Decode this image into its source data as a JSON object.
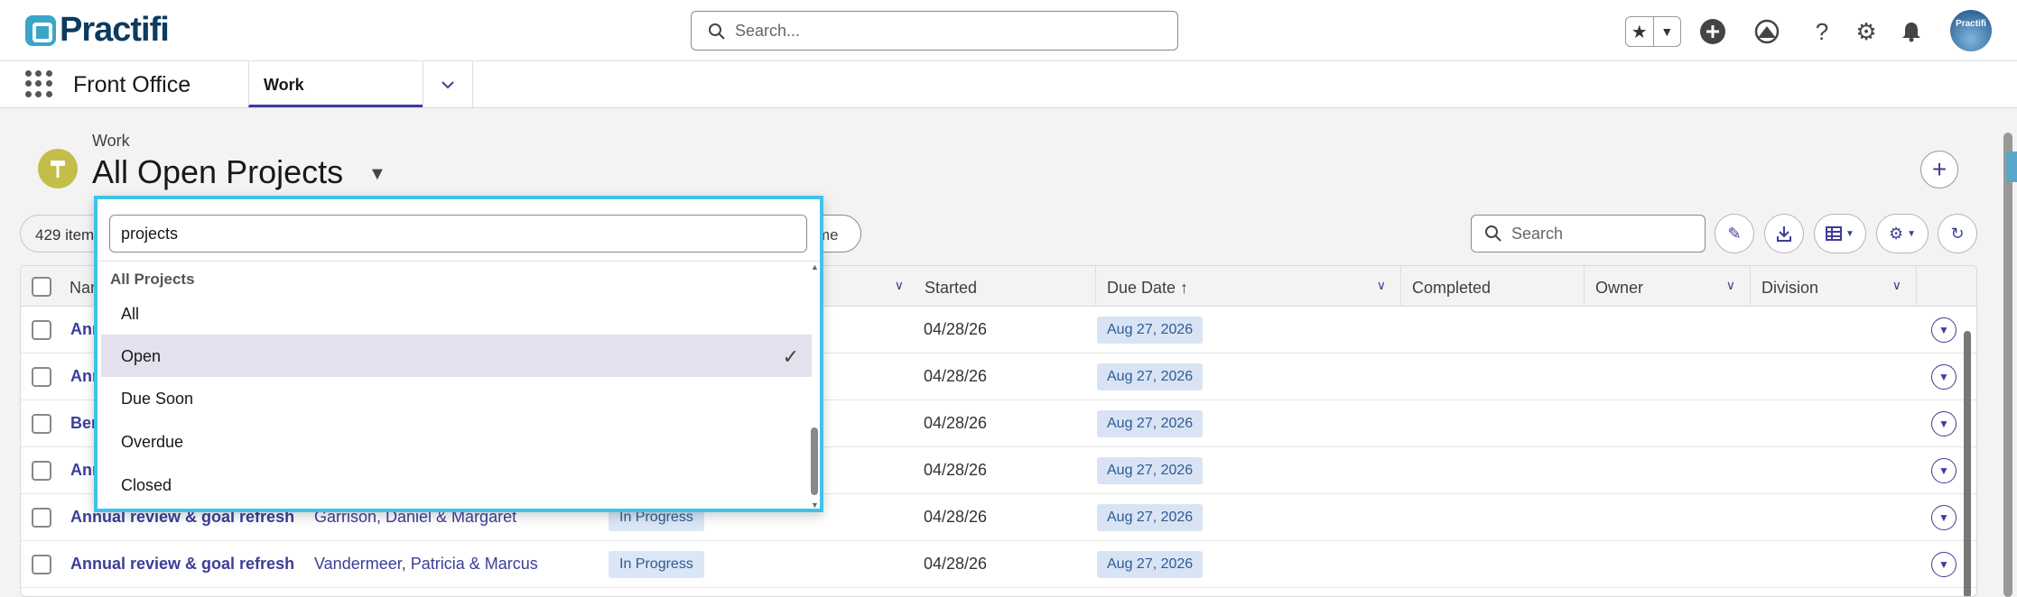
{
  "header": {
    "brand": "Practifi",
    "search_placeholder": "Search...",
    "avatar_text": "Practifi"
  },
  "nav": {
    "app_name": "Front Office",
    "active_tab": "Work"
  },
  "page": {
    "breadcrumb": "Work",
    "title": "All Open Projects",
    "item_count": "429 item",
    "hidden_pill_fragment": "me",
    "list_search_placeholder": "Search"
  },
  "table": {
    "columns": [
      "Nam",
      "Started",
      "Due Date ↑",
      "Completed",
      "Owner",
      "Division"
    ],
    "rows": [
      {
        "name": "Ann",
        "client": "",
        "status": "",
        "started": "04/28/26",
        "due": "Aug 27, 2026"
      },
      {
        "name": "Ann",
        "client": "",
        "status": "",
        "started": "04/28/26",
        "due": "Aug 27, 2026"
      },
      {
        "name": "Ber",
        "client": "",
        "status": "",
        "started": "04/28/26",
        "due": "Aug 27, 2026"
      },
      {
        "name": "Ann",
        "client": "",
        "status": "",
        "started": "04/28/26",
        "due": "Aug 27, 2026"
      },
      {
        "name": "Annual review & goal refresh",
        "client": "Garrison, Daniel & Margaret",
        "status": "In Progress",
        "started": "04/28/26",
        "due": "Aug 27, 2026"
      },
      {
        "name": "Annual review & goal refresh",
        "client": "Vandermeer, Patricia & Marcus",
        "status": "In Progress",
        "started": "04/28/26",
        "due": "Aug 27, 2026"
      }
    ]
  },
  "dropdown": {
    "search_value": "projects",
    "group_label": "All Projects",
    "items": [
      {
        "label": "All",
        "selected": false
      },
      {
        "label": "Open",
        "selected": true
      },
      {
        "label": "Due Soon",
        "selected": false
      },
      {
        "label": "Overdue",
        "selected": false
      },
      {
        "label": "Closed",
        "selected": false
      }
    ]
  },
  "colors": {
    "accent": "#3d3d9a",
    "focus_ring": "#3ec3ea",
    "object_icon": "#c3bd4a",
    "brand": "#0d3b5f"
  }
}
